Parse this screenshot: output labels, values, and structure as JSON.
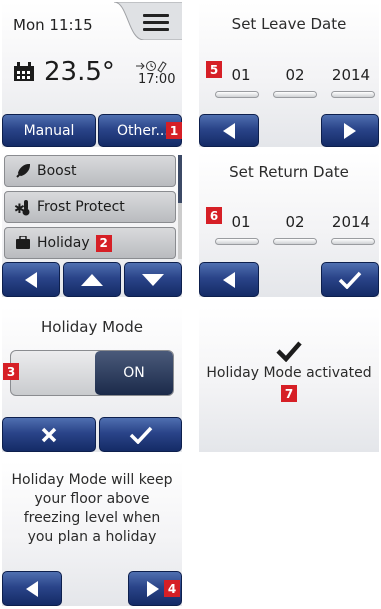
{
  "home": {
    "clock": "Mon 11:15",
    "temperature": "23.5°",
    "next_event_time": "17:00",
    "manual_label": "Manual",
    "other_label": "Other...",
    "badge": "1"
  },
  "menu": {
    "items": [
      {
        "label": "Boost",
        "icon": "rocket-icon"
      },
      {
        "label": "Frost Protect",
        "icon": "frost-icon"
      },
      {
        "label": "Holiday",
        "icon": "suitcase-icon"
      }
    ],
    "badge": "2"
  },
  "holiday_mode": {
    "title": "Holiday Mode",
    "toggle_label": "ON",
    "badge": "3"
  },
  "info": {
    "text": "Holiday Mode will keep your floor above freezing level when you plan a holiday",
    "badge": "4"
  },
  "leave": {
    "title": "Set Leave Date",
    "day": "01",
    "month": "02",
    "year": "2014",
    "badge": "5"
  },
  "return": {
    "title": "Set Return Date",
    "day": "01",
    "month": "02",
    "year": "2014",
    "badge": "6"
  },
  "confirm": {
    "text": "Holiday Mode activated",
    "badge": "7"
  },
  "colors": {
    "button_blue": "#1f3a7a",
    "badge_red": "#d61f26",
    "toggle_dark": "#1b2a4a"
  }
}
